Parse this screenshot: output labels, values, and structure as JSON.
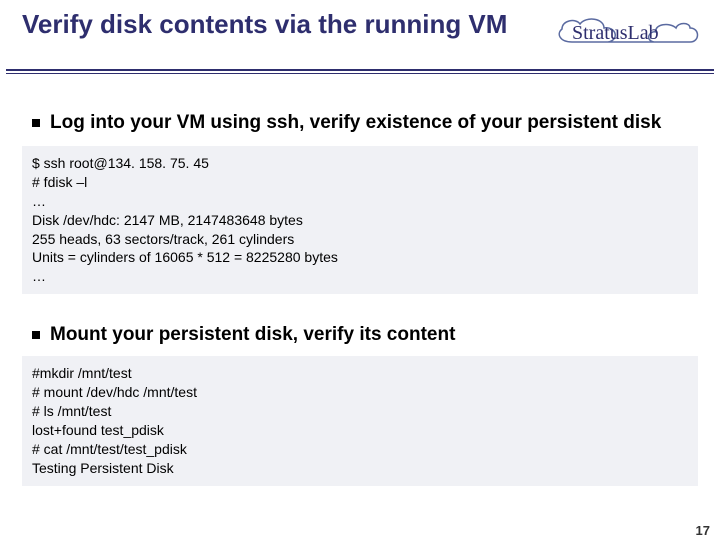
{
  "header": {
    "title": "Verify disk contents via the running VM",
    "logo_text": "StratusLab"
  },
  "bullets": {
    "b1": "Log into your VM using ssh, verify existence of your persistent disk",
    "b2": "Mount your persistent disk, verify its content"
  },
  "code1": "$ ssh root@134. 158. 75. 45\n# fdisk –l\n…\nDisk /dev/hdc: 2147 MB, 2147483648 bytes\n255 heads, 63 sectors/track, 261 cylinders\nUnits = cylinders of 16065 * 512 = 8225280 bytes\n…",
  "code2": "#mkdir /mnt/test\n# mount /dev/hdc /mnt/test\n# ls /mnt/test\nlost+found test_pdisk\n# cat /mnt/test/test_pdisk\nTesting Persistent Disk",
  "page_number": "17"
}
